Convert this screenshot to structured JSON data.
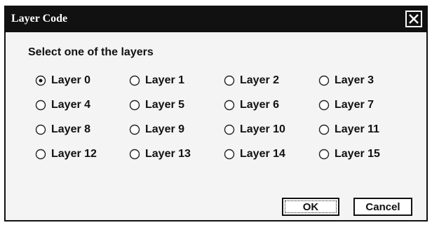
{
  "window": {
    "title": "Layer Code",
    "close_icon": "close-icon"
  },
  "prompt": "Select one of the layers",
  "selected_index": 0,
  "options": [
    {
      "label": "Layer 0"
    },
    {
      "label": "Layer 1"
    },
    {
      "label": "Layer 2"
    },
    {
      "label": "Layer 3"
    },
    {
      "label": "Layer 4"
    },
    {
      "label": "Layer 5"
    },
    {
      "label": "Layer 6"
    },
    {
      "label": "Layer 7"
    },
    {
      "label": "Layer 8"
    },
    {
      "label": "Layer 9"
    },
    {
      "label": "Layer 10"
    },
    {
      "label": "Layer 11"
    },
    {
      "label": "Layer 12"
    },
    {
      "label": "Layer 13"
    },
    {
      "label": "Layer 14"
    },
    {
      "label": "Layer 15"
    }
  ],
  "buttons": {
    "ok": "OK",
    "cancel": "Cancel"
  }
}
